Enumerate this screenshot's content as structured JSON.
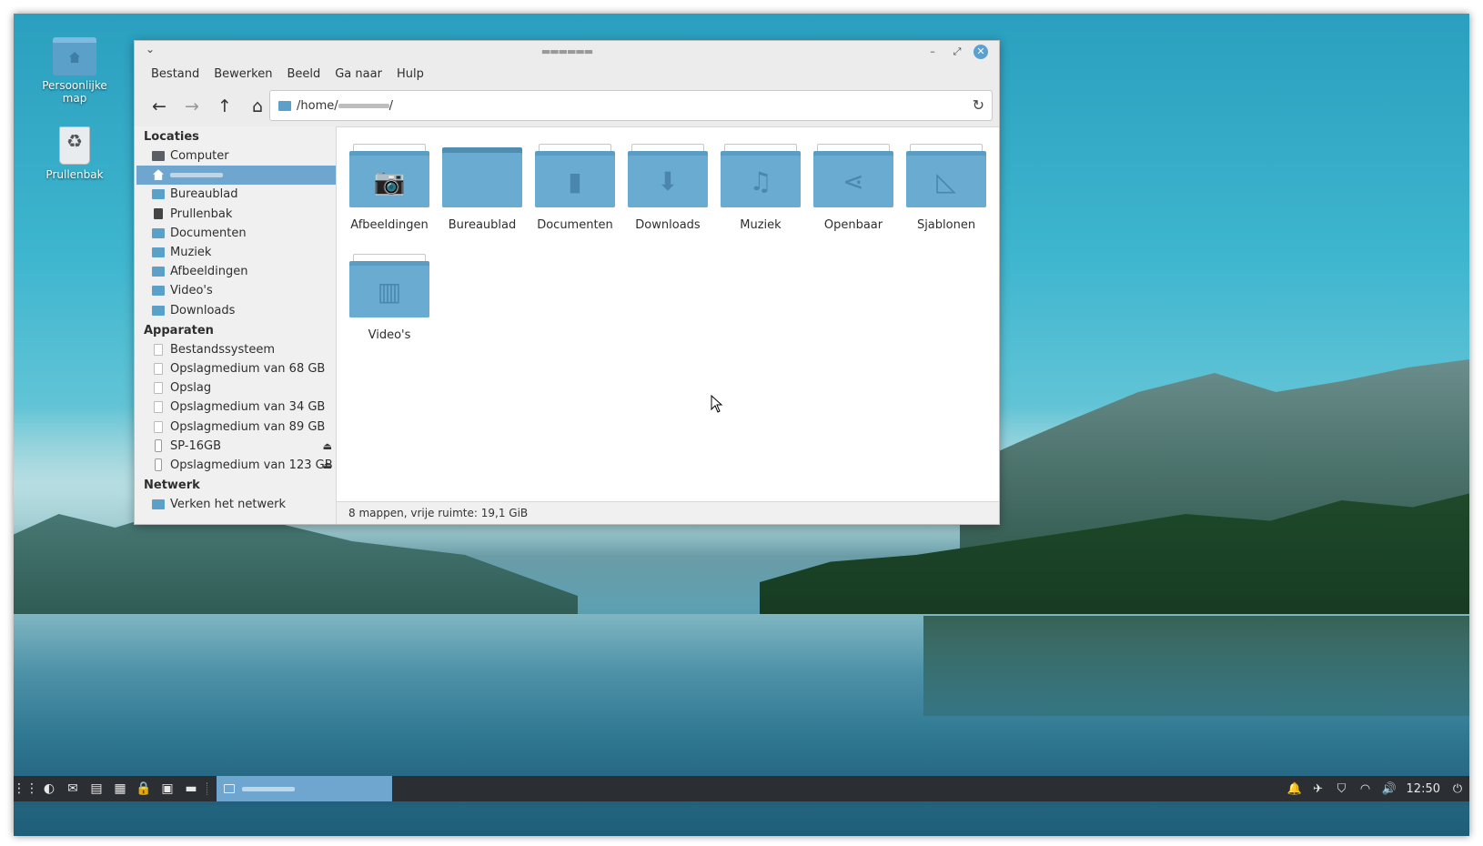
{
  "desktop": {
    "icons": [
      {
        "label": "Persoonlijke map"
      },
      {
        "label": "Prullenbak"
      }
    ]
  },
  "window": {
    "title": "▬▬▬▬▬▬",
    "chevron": "⌄",
    "minimize": "–",
    "maximize": "⤢",
    "close": "✕"
  },
  "menu": [
    "Bestand",
    "Bewerken",
    "Beeld",
    "Ga naar",
    "Hulp"
  ],
  "toolbar": {
    "back": "←",
    "forward": "→",
    "up": "↑",
    "home": "⌂",
    "path_prefix": "/home/",
    "path_suffix": "/",
    "refresh": "↻"
  },
  "sidebar": {
    "locaties_heading": "Locaties",
    "locaties": [
      {
        "label": "Computer",
        "icon": "computer-icon"
      },
      {
        "label": "",
        "icon": "home-icon",
        "selected": true
      },
      {
        "label": "Bureaublad",
        "icon": "folder-icon"
      },
      {
        "label": "Prullenbak",
        "icon": "trash-icon"
      },
      {
        "label": "Documenten",
        "icon": "folder-icon"
      },
      {
        "label": "Muziek",
        "icon": "folder-icon"
      },
      {
        "label": "Afbeeldingen",
        "icon": "folder-icon"
      },
      {
        "label": "Video's",
        "icon": "folder-icon"
      },
      {
        "label": "Downloads",
        "icon": "folder-icon"
      }
    ],
    "apparaten_heading": "Apparaten",
    "apparaten": [
      {
        "label": "Bestandssysteem"
      },
      {
        "label": "Opslagmedium van 68 GB"
      },
      {
        "label": "Opslag"
      },
      {
        "label": "Opslagmedium van 34 GB"
      },
      {
        "label": "Opslagmedium van 89 GB"
      },
      {
        "label": "SP-16GB",
        "eject": "⏏"
      },
      {
        "label": "Opslagmedium van 123 GB",
        "eject": "⏏"
      }
    ],
    "netwerk_heading": "Netwerk",
    "netwerk": [
      {
        "label": "Verken het netwerk"
      }
    ]
  },
  "folders": [
    {
      "label": "Afbeeldingen",
      "glyph": "📷"
    },
    {
      "label": "Bureaublad",
      "glyph": ""
    },
    {
      "label": "Documenten",
      "glyph": "▮"
    },
    {
      "label": "Downloads",
      "glyph": "⬇"
    },
    {
      "label": "Muziek",
      "glyph": "♫"
    },
    {
      "label": "Openbaar",
      "glyph": "⋖"
    },
    {
      "label": "Sjablonen",
      "glyph": "◺"
    },
    {
      "label": "Video's",
      "glyph": "▥"
    }
  ],
  "status": "8 mappen, vrije ruimte: 19,1 GiB",
  "taskbar": {
    "launchers": [
      "⋮⋮",
      "◐",
      "✉",
      "▤",
      "▦",
      "🔒",
      "▣",
      "▬"
    ],
    "task_label": "",
    "tray": [
      "🔔",
      "✈",
      "⛉",
      "◠",
      "🔊"
    ],
    "clock": "12:50",
    "power": "⏻"
  },
  "colors": {
    "accent": "#6ea6cf",
    "folder": "#6aabd1",
    "taskbar": "#2b2e33"
  }
}
